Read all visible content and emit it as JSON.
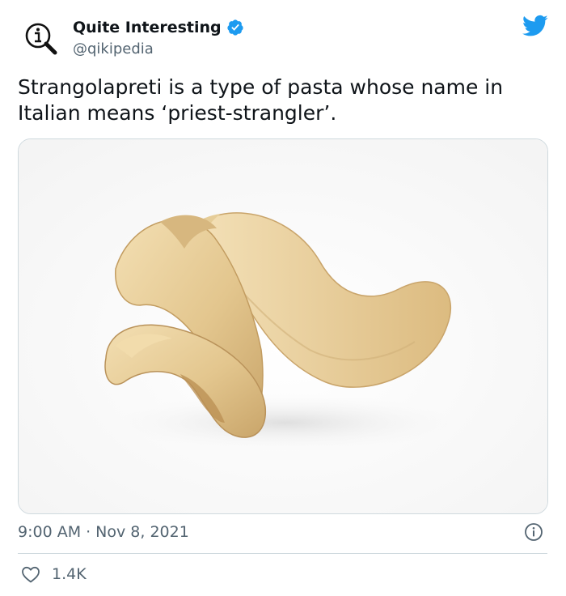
{
  "author": {
    "display_name": "Quite Interesting",
    "handle": "@qikipedia",
    "verified": true,
    "avatar_icon": "magnifier-info-icon"
  },
  "tweet": {
    "text": "Strangolapreti is a type of pasta whose name in Italian means ‘priest-strangler’.",
    "time": "9:00 AM",
    "separator": "·",
    "date": "Nov 8, 2021",
    "like_count": "1.4K"
  },
  "colors": {
    "brand_blue": "#1d9bf0",
    "text_primary": "#0f1419",
    "text_secondary": "#536471",
    "border": "#cfd9de"
  },
  "icons": {
    "brand": "twitter-bird-icon",
    "verified": "verified-badge-icon",
    "info": "info-icon",
    "like": "heart-icon"
  }
}
